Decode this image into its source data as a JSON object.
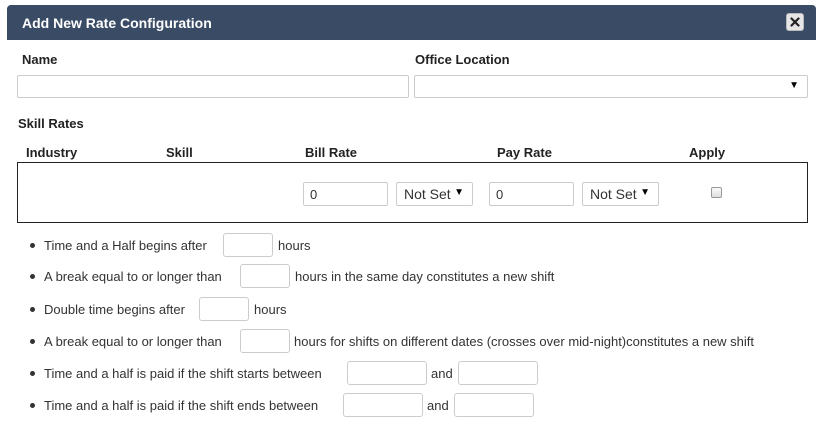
{
  "dialog": {
    "title": "Add New Rate Configuration",
    "close_icon": "close-icon"
  },
  "form": {
    "name_label": "Name",
    "name_value": "",
    "office_label": "Office Location",
    "office_value": ""
  },
  "skill_rates": {
    "section_label": "Skill Rates",
    "columns": [
      "Industry",
      "Skill",
      "Bill Rate",
      "Pay Rate",
      "Apply"
    ],
    "row": {
      "bill_rate": "0",
      "bill_rate_type": "Not Set",
      "pay_rate": "0",
      "pay_rate_type": "Not Set",
      "apply": false
    }
  },
  "rules": [
    {
      "before": "Time and a Half begins after",
      "after": "hours"
    },
    {
      "before": "A break equal to or longer than",
      "after": "hours in the same day constitutes a new shift"
    },
    {
      "before": "Double time begins after",
      "after": "hours"
    },
    {
      "before": "A break equal to or longer than",
      "after": "hours for shifts on different dates (crosses over mid-night)constitutes a new shift"
    },
    {
      "before": "Time and a half is paid if the shift starts between",
      "after": "and"
    },
    {
      "before": "Time and a half is paid if the shift ends between",
      "after": "and"
    }
  ]
}
